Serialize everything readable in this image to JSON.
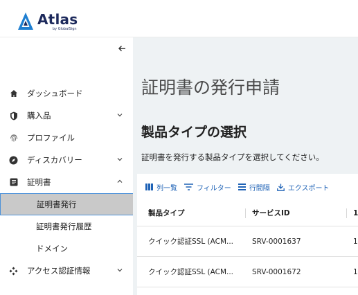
{
  "brand": {
    "name": "Atlas",
    "sub": "by GlobalSign"
  },
  "sidebar": {
    "collapse_icon": "arrow-left-icon",
    "items": [
      {
        "label": "ダッシュボード",
        "icon": "home-icon"
      },
      {
        "label": "購入品",
        "icon": "shield-icon",
        "expanded": false
      },
      {
        "label": "プロファイル",
        "icon": "fingerprint-icon"
      },
      {
        "label": "ディスカバリー",
        "icon": "compass-icon",
        "expanded": false
      },
      {
        "label": "証明書",
        "icon": "certificate-icon",
        "expanded": true
      },
      {
        "label": "アクセス認証情報",
        "icon": "access-icon",
        "expanded": false
      }
    ],
    "cert_sub": [
      {
        "label": "証明書発行",
        "active": true
      },
      {
        "label": "証明書発行履歴"
      },
      {
        "label": "ドメイン"
      }
    ]
  },
  "main": {
    "title": "証明書の発行申請",
    "section_title": "製品タイプの選択",
    "description": "証明書を発行する製品タイプを選択してください。",
    "toolbar": {
      "columns": "列一覧",
      "filter": "フィルター",
      "density": "行間隔",
      "export": "エクスポート"
    },
    "table": {
      "headers": [
        "製品タイプ",
        "サービスID",
        "1"
      ],
      "rows": [
        [
          "クイック認証SSL (ACM...",
          "SRV-0001637",
          "1"
        ],
        [
          "クイック認証SSL (ACM...",
          "SRV-0001672",
          "1"
        ]
      ]
    }
  },
  "colors": {
    "accent": "#1e62b6",
    "brand": "#1d2a5c",
    "active_bg": "#c9c9c9",
    "active_border": "#4a90d9",
    "main_bg": "#eef2f4"
  }
}
